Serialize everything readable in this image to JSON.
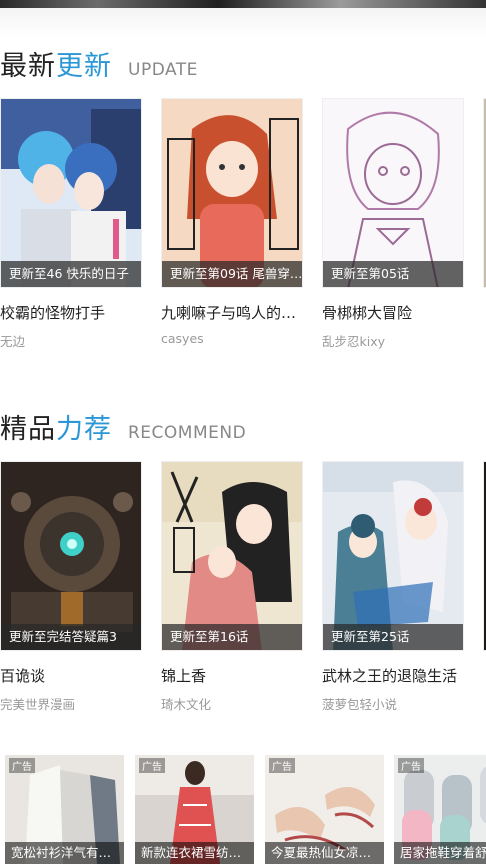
{
  "sections": [
    {
      "title_main": "最新",
      "title_accent": "更新",
      "subtitle": "UPDATE",
      "cards": [
        {
          "badge": "更新至46 快乐的日子",
          "title": "校霸的怪物打手",
          "author": "无边"
        },
        {
          "badge": "更新至第09话 尾兽穿…",
          "title": "九喇嘛子与鸣人的…",
          "author": "casyes"
        },
        {
          "badge": "更新至第05话",
          "title": "骨梆梆大冒险",
          "author": "乱步忍kixy"
        }
      ]
    },
    {
      "title_main": "精品",
      "title_accent": "力荐",
      "subtitle": "RECOMMEND",
      "cards": [
        {
          "badge": "更新至完结答疑篇3",
          "title": "百诡谈",
          "author": "完美世界漫画"
        },
        {
          "badge": "更新至第16话",
          "title": "锦上香",
          "author": "琦木文化"
        },
        {
          "badge": "更新至第25话",
          "title": "武林之王的退隐生活",
          "author": "菠萝包轻小说"
        }
      ]
    }
  ],
  "ads": {
    "badge": "广告",
    "items": [
      {
        "caption": "宽松衬衫洋气有…"
      },
      {
        "caption": "新款连衣裙雪纺…"
      },
      {
        "caption": "今夏最热仙女凉…"
      },
      {
        "caption": "居家拖鞋穿着舒…"
      }
    ]
  },
  "colors": {
    "accent": "#2b97d6",
    "badge_bg": "rgba(40,40,40,0.72)"
  }
}
